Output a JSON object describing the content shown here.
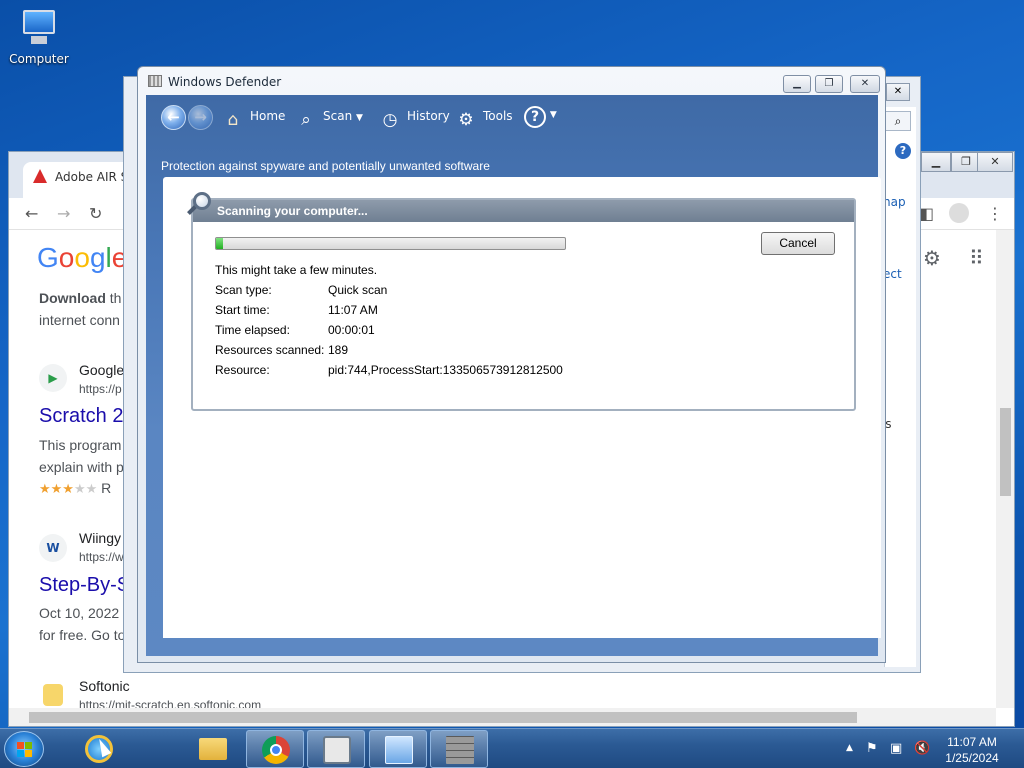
{
  "desktop": {
    "computer_label": "Computer"
  },
  "chrome": {
    "tab_title": "Adobe AIR S",
    "google_logo": [
      "G",
      "o",
      "o",
      "g",
      "l",
      "e"
    ],
    "results": {
      "snippet1_bold": "Download",
      "snippet1_rest": " th",
      "snippet1_line2": "internet conn",
      "r1_site": "Google",
      "r1_url": "https://p",
      "r1_title": "Scratch 2",
      "r1_line1": "This program",
      "r1_line2": "explain with p",
      "r1_rating_suffix": "R",
      "r2_fav": "W",
      "r2_site": "Wiingy",
      "r2_url": "https://w",
      "r2_title": "Step-By-S",
      "r2_line1": "Oct 10, 2022",
      "r2_line2": "for free. Go to",
      "r3_site": "Softonic",
      "r3_url": "https://mit-scratch.en.softonic.com"
    },
    "right_fragments": {
      "map": "hap",
      "ect": "ect",
      "ss": "ss"
    }
  },
  "defender": {
    "title": "Windows Defender",
    "toolbar": {
      "home": "Home",
      "scan": "Scan",
      "history": "History",
      "tools": "Tools",
      "help_glyph": "?"
    },
    "subtitle": "Protection against spyware and potentially unwanted software",
    "scan": {
      "header": "Scanning your computer...",
      "progress": 0.02,
      "cancel_label": "Cancel",
      "message": "This might take a few minutes.",
      "fields": [
        {
          "label": "Scan type:",
          "value": "Quick scan"
        },
        {
          "label": "Start time:",
          "value": "11:07 AM"
        },
        {
          "label": "Time elapsed:",
          "value": "00:00:01"
        },
        {
          "label": "Resources scanned:",
          "value": "189"
        },
        {
          "label": "Resource:",
          "value": "pid:744,ProcessStart:133506573912812500"
        }
      ]
    }
  },
  "taskbar": {
    "time": "11:07 AM",
    "date": "1/25/2024"
  }
}
